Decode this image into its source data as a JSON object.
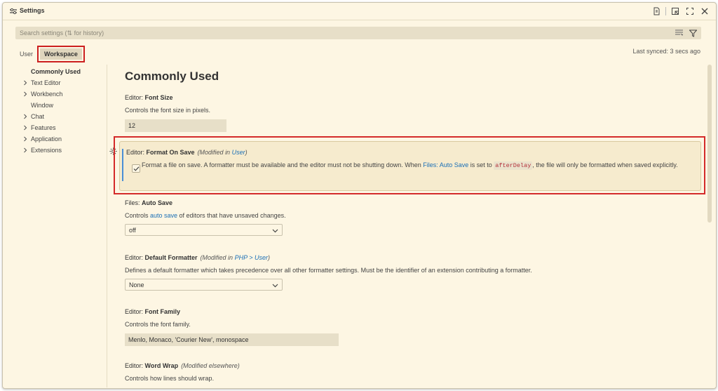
{
  "window": {
    "title": "Settings"
  },
  "search": {
    "placeholder": "Search settings (⇅ for history)"
  },
  "scope_tabs": {
    "user": "User",
    "workspace": "Workspace"
  },
  "sync_status": "Last synced: 3 secs ago",
  "toc": [
    {
      "label": "Commonly Used",
      "active": true,
      "expandable": false
    },
    {
      "label": "Text Editor",
      "expandable": true
    },
    {
      "label": "Workbench",
      "expandable": true
    },
    {
      "label": "Window",
      "expandable": false
    },
    {
      "label": "Chat",
      "expandable": true
    },
    {
      "label": "Features",
      "expandable": true
    },
    {
      "label": "Application",
      "expandable": true
    },
    {
      "label": "Extensions",
      "expandable": true
    }
  ],
  "section_title": "Commonly Used",
  "settings": {
    "font_size": {
      "category": "Editor: ",
      "name": "Font Size",
      "description": "Controls the font size in pixels.",
      "value": "12"
    },
    "format_on_save": {
      "category": "Editor: ",
      "name": "Format On Save",
      "modified_prefix": "(Modified in ",
      "modified_link": "User",
      "modified_suffix": ")",
      "desc_1": "Format a file on save. A formatter must be available and the editor must not be shutting down. When ",
      "desc_link": "Files: Auto Save",
      "desc_2": " is set to ",
      "desc_code": "afterDelay",
      "desc_3": ", the file will only be formatted when saved explicitly.",
      "checked": true
    },
    "auto_save": {
      "category": "Files: ",
      "name": "Auto Save",
      "desc_1": "Controls ",
      "desc_link": "auto save",
      "desc_2": " of editors that have unsaved changes.",
      "value": "off"
    },
    "default_formatter": {
      "category": "Editor: ",
      "name": "Default Formatter",
      "modified_prefix": "(Modified in ",
      "modified_link": "PHP > User",
      "modified_suffix": ")",
      "description": "Defines a default formatter which takes precedence over all other formatter settings. Must be the identifier of an extension contributing a formatter.",
      "value": "None"
    },
    "font_family": {
      "category": "Editor: ",
      "name": "Font Family",
      "description": "Controls the font family.",
      "value": "Menlo, Monaco, 'Courier New', monospace"
    },
    "word_wrap": {
      "category": "Editor: ",
      "name": "Word Wrap",
      "modified": "(Modified elsewhere)",
      "description": "Controls how lines should wrap."
    }
  },
  "colors": {
    "background": "#fdf6e3",
    "link": "#1a6fb6",
    "highlight_border": "#d42a2a",
    "focus_bar": "#4a8fd6"
  }
}
